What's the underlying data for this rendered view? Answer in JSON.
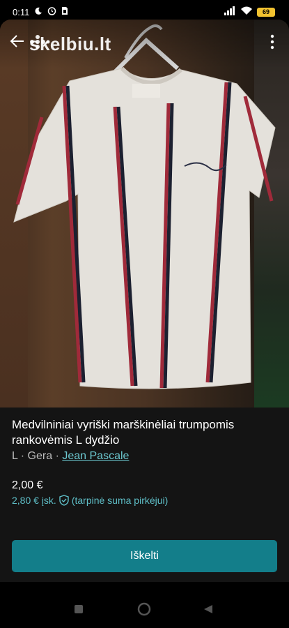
{
  "status_bar": {
    "time": "0:11",
    "battery": "69"
  },
  "header": {
    "logo_text": "skelbiu.lt"
  },
  "listing": {
    "title": "Medvilniniai vyriški marškinėliai trumpomis rankovėmis L dydžio",
    "size": "L",
    "separator": "·",
    "condition": "Gera",
    "brand": "Jean Pascale",
    "price": "2,00 €",
    "price_incl": "2,80 € įsk.",
    "price_incl_note": "(tarpinė suma pirkėjui)"
  },
  "actions": {
    "bump_label": "Iškelti"
  },
  "colors": {
    "accent": "#137e8a",
    "link": "#6cc8d0"
  }
}
